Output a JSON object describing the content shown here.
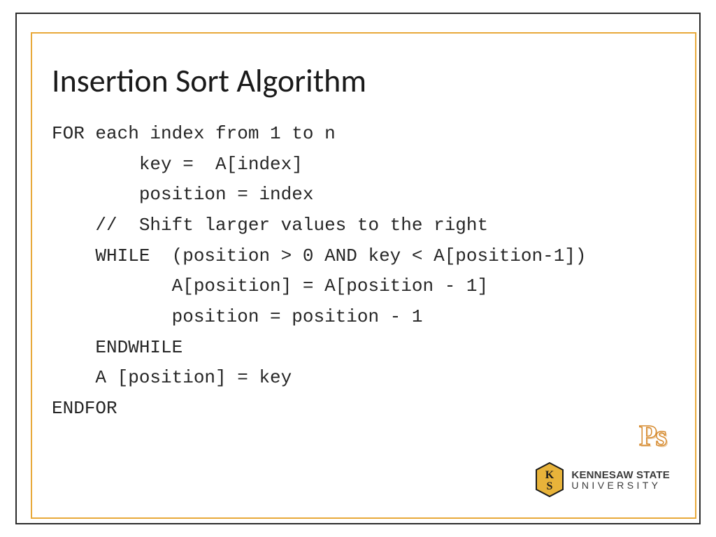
{
  "title": "Insertion Sort Algorithm",
  "code": {
    "l0": "FOR each index from 1 to n",
    "l1": "        key =  A[index]",
    "l2": "        position = index",
    "l3": "    //  Shift larger values to the right",
    "l4": "    WHILE  (position > 0 AND key < A[position-1])",
    "l5": "           A[position] = A[position - 1]",
    "l6": "           position = position - 1",
    "l7": "    ENDWHILE",
    "l8": "    A [position] = key",
    "l9": "ENDFOR"
  },
  "mark": "Ps",
  "university": {
    "line1": "KENNESAW STATE",
    "line2": "UNIVERSITY"
  }
}
